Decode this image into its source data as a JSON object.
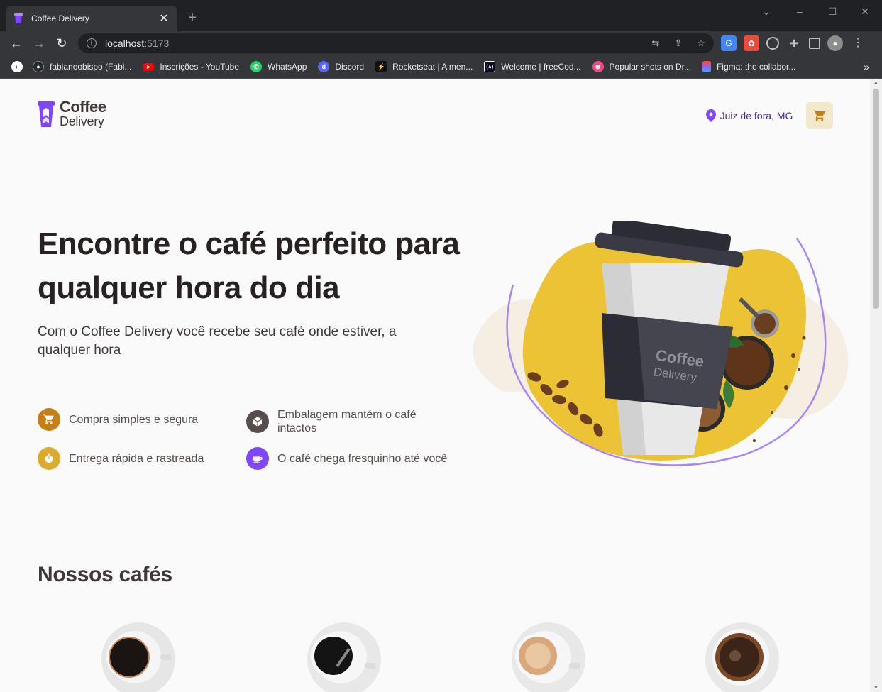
{
  "browser": {
    "tab_title": "Coffee Delivery",
    "close_glyph": "✕",
    "new_tab_glyph": "+",
    "url_host": "localhost",
    "url_port": ":5173",
    "bookmarks": [
      {
        "label": "fabianoobispo (Fabi...",
        "icon": "github-icon",
        "color": "#24292e"
      },
      {
        "label": "Inscrições - YouTube",
        "icon": "youtube-icon",
        "color": "#ff0000"
      },
      {
        "label": "WhatsApp",
        "icon": "whatsapp-icon",
        "color": "#25d366"
      },
      {
        "label": "Discord",
        "icon": "discord-icon",
        "color": "#5865f2"
      },
      {
        "label": "Rocketseat | A men...",
        "icon": "rocketseat-icon",
        "color": "#8257e5"
      },
      {
        "label": "Welcome | freeCod...",
        "icon": "freecodecamp-icon",
        "color": "#0a0a23"
      },
      {
        "label": "Popular shots on Dr...",
        "icon": "dribbble-icon",
        "color": "#ea4c89"
      },
      {
        "label": "Figma: the collabor...",
        "icon": "figma-icon",
        "color": "#f24e1e"
      }
    ],
    "bookmarks_more": "»"
  },
  "header": {
    "logo_line1": "Coffee",
    "logo_line2": "Delivery",
    "location": "Juiz de fora, MG",
    "colors": {
      "purple": "#8047f8",
      "yellow_dark": "#c47f17",
      "yellow_light": "#f1e9c9"
    }
  },
  "hero": {
    "title": "Encontre o café perfeito para qualquer hora do dia",
    "subtitle": "Com o Coffee Delivery você recebe seu café onde estiver, a qualquer hora",
    "features": [
      {
        "text": "Compra simples e segura",
        "icon": "cart-icon",
        "color": "#c47f17"
      },
      {
        "text": "Embalagem mantém o café intactos",
        "icon": "package-icon",
        "color": "#574f4d"
      },
      {
        "text": "Entrega rápida e rastreada",
        "icon": "timer-icon",
        "color": "#dbac2c"
      },
      {
        "text": "O café chega fresquinho até você",
        "icon": "coffee-icon",
        "color": "#8047f8"
      }
    ],
    "cup_brand_line1": "Coffee",
    "cup_brand_line2": "Delivery"
  },
  "menu": {
    "title": "Nossos cafés"
  }
}
